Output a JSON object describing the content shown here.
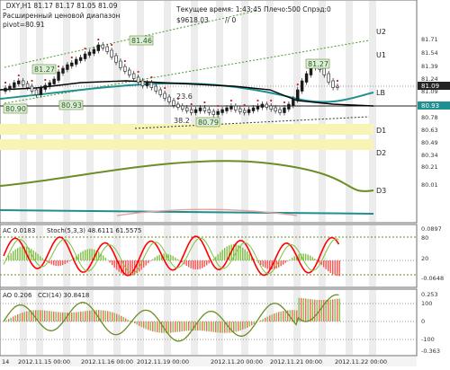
{
  "header": {
    "symbol_ohlc": "_DXY,H1  81.17 81.17 81.05 81.09",
    "indicator_name": "Расширенный ценовой диапазон",
    "pivot": "pivot=80.91",
    "server_time": "Текущее время: 1:43:45 Плечо:500 Спрэд:0",
    "balance": "$9618.03",
    "counter": "// 0"
  },
  "level_labels": {
    "u2": "U2",
    "u1": "U1",
    "lb": "LB",
    "d1": "D1",
    "d2": "D2",
    "d3": "D3"
  },
  "chart_tags": {
    "h1": "81.46",
    "h2": "81.27",
    "h3": "81.27",
    "l1": "80.90",
    "l2": "80.93",
    "l3": "80.79",
    "fib1": "23.6",
    "fib2": "38.2"
  },
  "price_axis": {
    "ticks": [
      "81.71",
      "81.54",
      "81.39",
      "81.24",
      "81.09",
      "80.93",
      "80.78",
      "80.63",
      "80.49",
      "80.34",
      "80.21",
      "80.01"
    ],
    "current_label": "81.09",
    "pivot_label": "80.93"
  },
  "ac_panel": {
    "label": "AC 0.0183",
    "stoch_label": "Stoch(5,3,3) 48.6111 61.5575",
    "axis_ticks": [
      "0.0897",
      "80",
      "20",
      "-0.0648"
    ]
  },
  "ao_panel": {
    "label": "AO 0.206",
    "cci_label": "CCI(14) 30.8418",
    "axis_ticks": [
      "0.253",
      "100",
      "0",
      "-100",
      "-0.363"
    ]
  },
  "time_axis": {
    "labels": [
      "14",
      "2012.11.15 00:00",
      "2012.11.16 00:00",
      "2012.11.19 00:00",
      "2012.11.20 00:00",
      "2012.11.21 00:00",
      "2012.11.22 00:00"
    ]
  },
  "colors": {
    "up_candle": "#1a1a1a",
    "down_candle": "#1a1a1a",
    "ma_teal": "#1f8f8f",
    "ma_black": "#000000",
    "ma_olive": "#6b8e23",
    "ma_pink": "#e8a0a0",
    "zone_yellow": "#f7f4b5",
    "stoch_red": "#ff0000",
    "ac_osc": "#7fc241",
    "cci_olive": "#6b8e23"
  }
}
